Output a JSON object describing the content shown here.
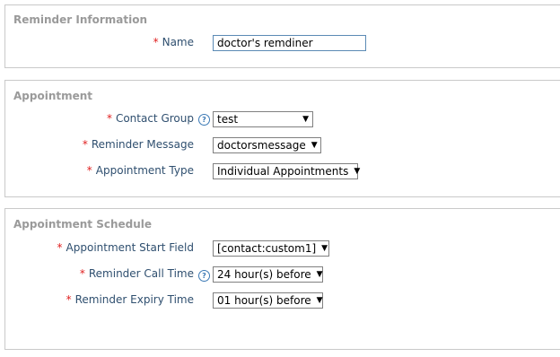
{
  "reminder_info": {
    "title": "Reminder Information",
    "name_label": "Name",
    "name_value": "doctor's remdiner"
  },
  "appointment": {
    "title": "Appointment",
    "contact_group_label": "Contact Group",
    "contact_group_value": "test",
    "reminder_message_label": "Reminder Message",
    "reminder_message_value": "doctorsmessage",
    "appointment_type_label": "Appointment Type",
    "appointment_type_value": "Individual Appointments"
  },
  "schedule": {
    "title": "Appointment Schedule",
    "start_field_label": "Appointment Start Field",
    "start_field_value": "[contact:custom1]",
    "call_time_label": "Reminder Call Time",
    "call_time_value": "24 hour(s) before",
    "expiry_time_label": "Reminder Expiry Time",
    "expiry_time_value": "01 hour(s) before"
  },
  "required_marker": "*",
  "help_symbol": "?",
  "caret_symbol": "▼",
  "icons": [
    "help-icon",
    "chevron-down-icon"
  ]
}
